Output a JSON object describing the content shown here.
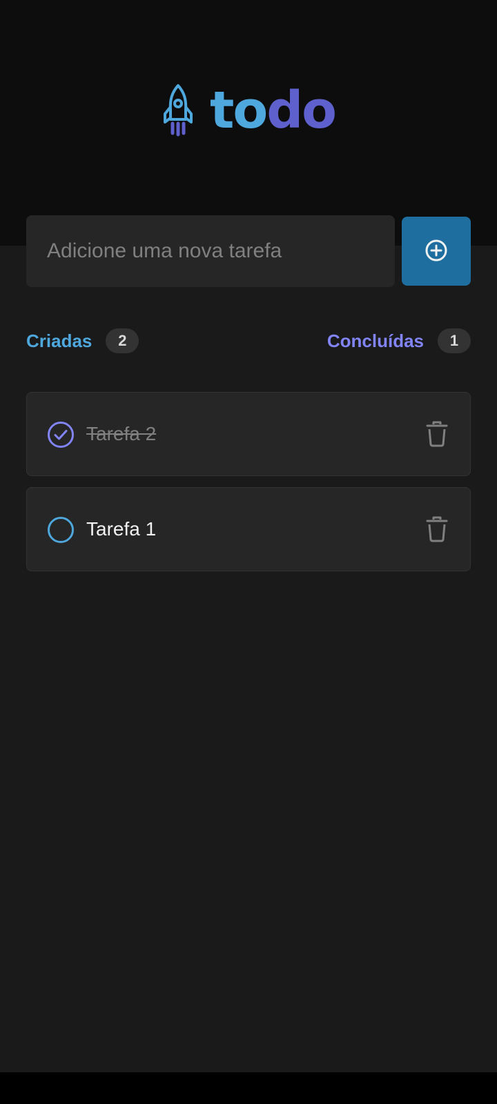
{
  "brand": {
    "logo_part1": "to",
    "logo_part2": "do",
    "color_primary": "#4ea8de",
    "color_secondary": "#5e60ce"
  },
  "new_task": {
    "placeholder": "Adicione uma nova tarefa",
    "value": "",
    "add_icon": "plus-circle-icon"
  },
  "counters": {
    "created": {
      "label": "Criadas",
      "count": "2",
      "color": "#4ea8de"
    },
    "done": {
      "label": "Concluídas",
      "count": "1",
      "color": "#8284fa"
    }
  },
  "tasks": [
    {
      "label": "Tarefa 2",
      "completed": true,
      "check_icon": "check-circle-icon",
      "delete_icon": "trash-icon"
    },
    {
      "label": "Tarefa 1",
      "completed": false,
      "check_icon": "empty-circle-icon",
      "delete_icon": "trash-icon"
    }
  ],
  "colors": {
    "background": "#1a1a1a",
    "header_background": "#0d0d0d",
    "card_background": "#262626",
    "add_button": "#1e6f9f",
    "check_done": "#8284fa",
    "check_pending": "#4ea8de"
  }
}
